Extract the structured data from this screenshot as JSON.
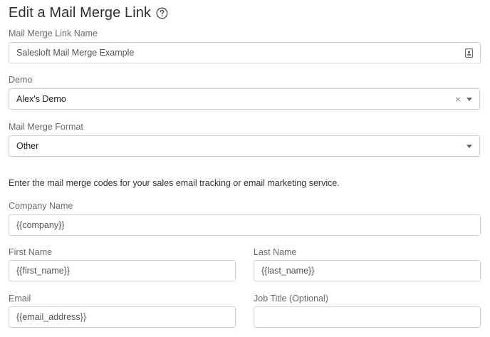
{
  "header": {
    "title": "Edit a Mail Merge Link",
    "help_icon": "question-circle-icon"
  },
  "form": {
    "link_name": {
      "label": "Mail Merge Link Name",
      "value": "Salesloft Mail Merge Example",
      "icon": "contact-card-icon"
    },
    "demo": {
      "label": "Demo",
      "value": "Alex's Demo",
      "clear_glyph": "×"
    },
    "format": {
      "label": "Mail Merge Format",
      "value": "Other"
    },
    "instructions": "Enter the mail merge codes for your sales email tracking or email marketing service.",
    "company_name": {
      "label": "Company Name",
      "value": "{{company}}"
    },
    "first_name": {
      "label": "First Name",
      "value": "{{first_name}}"
    },
    "last_name": {
      "label": "Last Name",
      "value": "{{last_name}}"
    },
    "email": {
      "label": "Email",
      "value": "{{email_address}}"
    },
    "job_title": {
      "label": "Job Title (Optional)",
      "value": ""
    }
  }
}
